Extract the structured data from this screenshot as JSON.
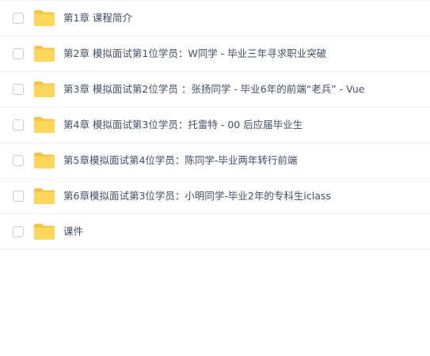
{
  "files": [
    {
      "name": "第1章 课程简介",
      "type": "folder-icon"
    },
    {
      "name": "第2章 模拟面试第1位学员：W同学 - 毕业三年寻求职业突破",
      "type": "folder-icon"
    },
    {
      "name": "第3章 模拟面试第2位学员 ：张扬同学 - 毕业6年的前端“老兵” - Vue",
      "type": "folder-icon"
    },
    {
      "name": "第4章 模拟面试第3位学员：托雷特 - 00 后应届毕业生",
      "type": "folder-icon"
    },
    {
      "name": "第5章模拟面试第4位学员：陈同学-毕业两年转行前端",
      "type": "folder-icon"
    },
    {
      "name": "第6章模拟面试第3位学员：小明同学-毕业2年的专科生iclass",
      "type": "folder-icon"
    },
    {
      "name": "课件",
      "type": "folder-icon"
    }
  ],
  "colors": {
    "folder_back": "#f6c342",
    "folder_front": "#fdd65b",
    "text": "#424e67",
    "divider": "#f1f2f4",
    "checkbox_border": "#c9ccd3"
  }
}
